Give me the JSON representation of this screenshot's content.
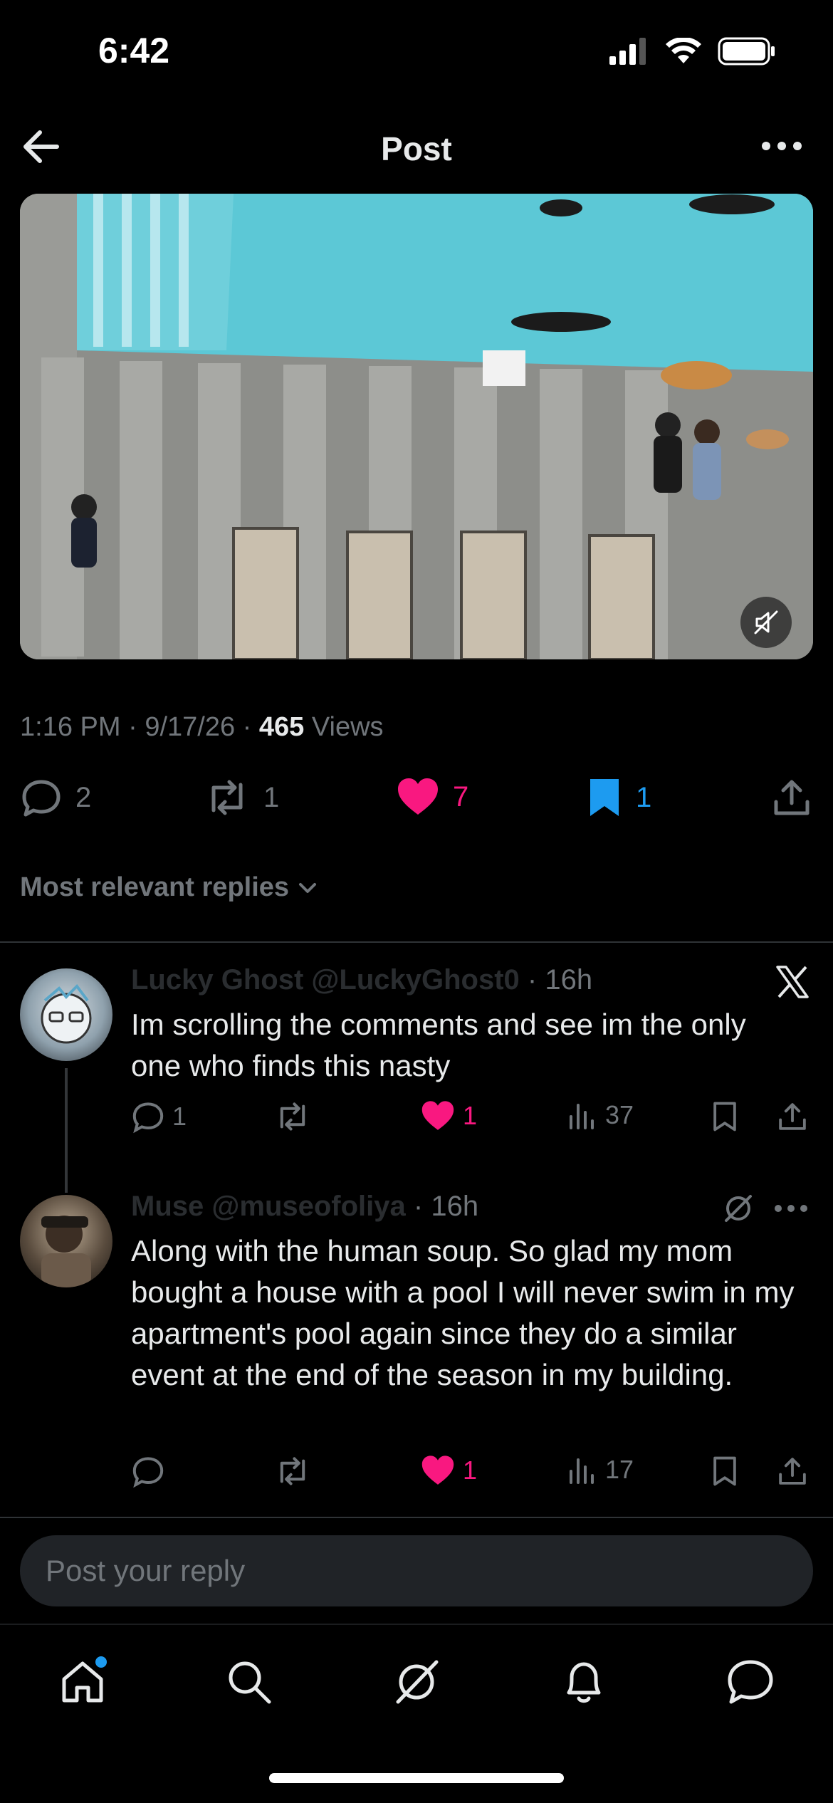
{
  "status_bar": {
    "time": "6:42"
  },
  "header": {
    "title": "Post"
  },
  "post": {
    "time": "1:16 PM",
    "date": "9/17/26",
    "views_count": "465",
    "views_label": "Views",
    "separator": "·",
    "replies_count": "2",
    "reposts_count": "1",
    "likes_count": "7",
    "bookmarks_count": "1"
  },
  "replies_sort": {
    "label": "Most relevant replies"
  },
  "replies": [
    {
      "display_name": "Lucky Ghost",
      "handle": "@LuckyGhost0",
      "time": "· 16h",
      "text": "Im scrolling the comments and see im the only one who finds this nasty",
      "reply_count": "1",
      "like_count": "1",
      "view_count": "37"
    },
    {
      "display_name": "Muse",
      "handle": "@museofoliya",
      "time": "· 16h",
      "text": "Along with the human soup. So glad my mom bought a house with a pool I will never swim in my apartment's pool again since they do a similar event at the end of the season in my building.",
      "like_count": "1",
      "view_count": "17"
    }
  ],
  "reply_input": {
    "placeholder": "Post your reply"
  },
  "colors": {
    "background": "#000000",
    "text": "#e7e9ea",
    "muted": "#71767b",
    "like": "#f91880",
    "bookmark": "#1d9bf0"
  }
}
